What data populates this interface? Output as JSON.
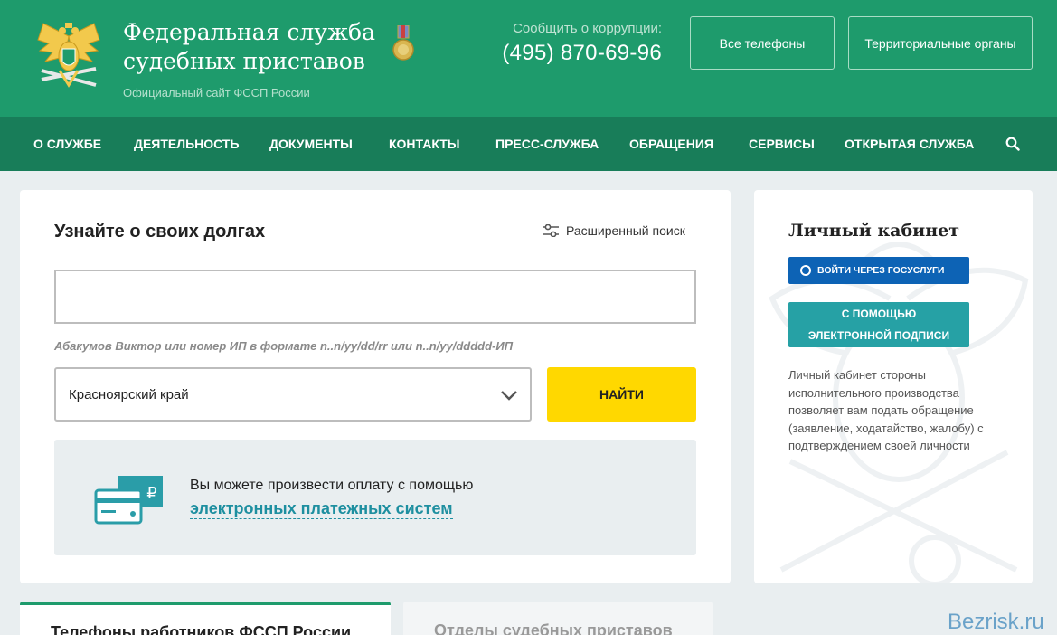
{
  "header": {
    "title": "Федеральная служба судебных приставов",
    "subtitle": "Официальный сайт ФССП России",
    "corruption_label": "Сообщить о коррупции:",
    "corruption_phone": "(495) 870-69-96",
    "all_phones_label": "Все телефоны",
    "territorial_label": "Территориальные органы"
  },
  "nav": {
    "items": [
      "О СЛУЖБЕ",
      "ДЕЯТЕЛЬНОСТЬ",
      "ДОКУМЕНТЫ",
      "КОНТАКТЫ",
      "ПРЕСС-СЛУЖБА",
      "ОБРАЩЕНИЯ",
      "СЕРВИСЫ",
      "ОТКРЫТАЯ СЛУЖБА"
    ],
    "search_icon": "search-icon"
  },
  "debt_search": {
    "title": "Узнайте о своих долгах",
    "advanced_label": "Расширенный поиск",
    "input_value": "",
    "hint": "Абакумов Виктор или номер ИП в формате n..n/yy/dd/rr или n..n/yy/ddddd-ИП",
    "region_selected": "Красноярский край",
    "find_label": "НАЙТИ",
    "payment_text": "Вы можете произвести оплату с помощью",
    "payment_link": "электронных платежных систем",
    "currency_symbol": "₽"
  },
  "cabinet": {
    "title": "Личный кабинет",
    "gosuslugi_label": "ВОЙТИ ЧЕРЕЗ ГОСУСЛУГИ",
    "signature_line1": "С ПОМОЩЬЮ",
    "signature_line2": "ЭЛЕКТРОННОЙ ПОДПИСИ",
    "description": "Личный кабинет стороны исполнительного производства позволяет вам подать обращение (заявление, ходатайство, жалобу) с подтверждением своей личности"
  },
  "tabs": {
    "phones": "Телефоны работников ФССП России",
    "departments": "Отделы судебных приставов"
  },
  "watermark": "Bezrisk.ru",
  "colors": {
    "header_green": "#1e9b6c",
    "nav_green": "#187d59",
    "find_yellow": "#ffd800",
    "gosuslugi_blue": "#0d63b5",
    "signature_teal": "#26a1a5",
    "link_teal": "#1e8fa0"
  }
}
